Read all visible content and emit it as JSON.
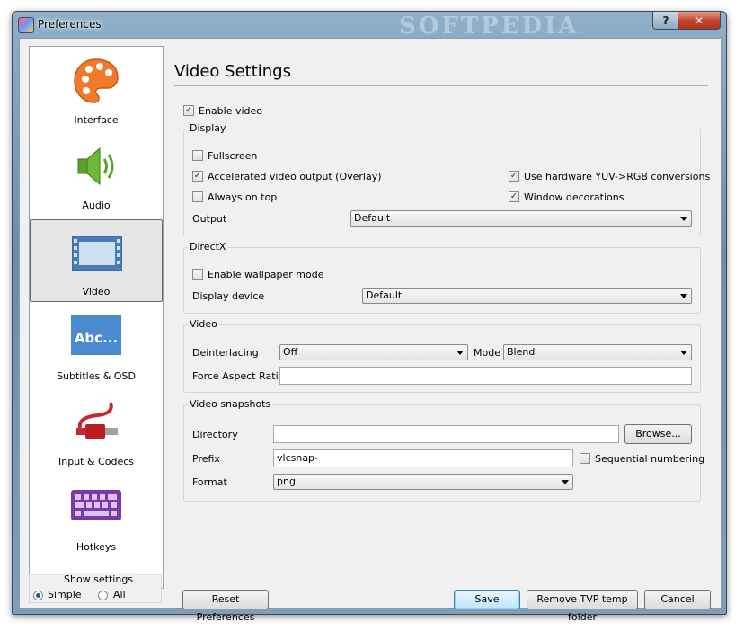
{
  "window": {
    "title": "Preferences",
    "watermark": "SOFTPEDIA",
    "help_label": "?",
    "close_label": "✕"
  },
  "sidebar": {
    "categories": [
      {
        "label": "Interface",
        "icon": "palette-icon"
      },
      {
        "label": "Audio",
        "icon": "speaker-icon"
      },
      {
        "label": "Video",
        "icon": "film-icon",
        "selected": true
      },
      {
        "label": "Subtitles & OSD",
        "icon": "subtitles-icon",
        "icon_text": "Abc..."
      },
      {
        "label": "Input & Codecs",
        "icon": "cable-icon"
      },
      {
        "label": "Hotkeys",
        "icon": "keyboard-icon"
      }
    ],
    "show_settings": {
      "label": "Show settings",
      "options": [
        "Simple",
        "All"
      ],
      "selected": "Simple"
    }
  },
  "main": {
    "title": "Video Settings",
    "enable_video": {
      "label": "Enable video",
      "checked": true
    },
    "display": {
      "title": "Display",
      "fullscreen": {
        "label": "Fullscreen",
        "checked": false
      },
      "accelerated": {
        "label": "Accelerated video output (Overlay)",
        "checked": true
      },
      "always_on_top": {
        "label": "Always on top",
        "checked": false
      },
      "hw_yuv": {
        "label": "Use hardware YUV->RGB conversions",
        "checked": true
      },
      "window_decorations": {
        "label": "Window decorations",
        "checked": true
      },
      "output_label": "Output",
      "output_value": "Default"
    },
    "directx": {
      "title": "DirectX",
      "wallpaper": {
        "label": "Enable wallpaper mode",
        "checked": false
      },
      "device_label": "Display device",
      "device_value": "Default"
    },
    "video": {
      "title": "Video",
      "deinterlacing_label": "Deinterlacing",
      "deinterlacing_value": "Off",
      "mode_label": "Mode",
      "mode_value": "Blend",
      "aspect_label": "Force Aspect Ratio",
      "aspect_value": ""
    },
    "snapshots": {
      "title": "Video snapshots",
      "directory_label": "Directory",
      "directory_value": "",
      "browse_label": "Browse...",
      "prefix_label": "Prefix",
      "prefix_value": "vlcsnap-",
      "sequential": {
        "label": "Sequential numbering",
        "checked": false
      },
      "format_label": "Format",
      "format_value": "png"
    }
  },
  "footer": {
    "reset_label": "Reset Preferences",
    "save_label": "Save",
    "remove_tvp_label": "Remove TVP temp folder",
    "cancel_label": "Cancel"
  },
  "checkmark": "✓"
}
